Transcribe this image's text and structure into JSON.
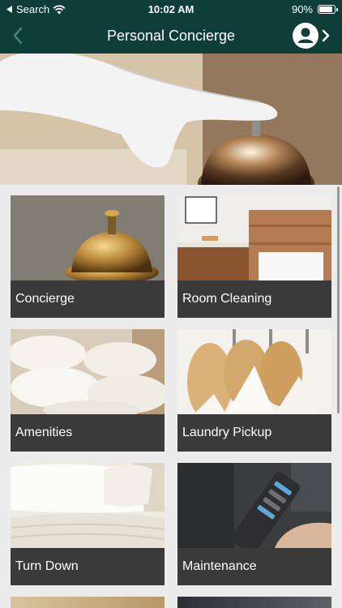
{
  "status_bar": {
    "back_app": "Search",
    "time": "10:02 AM",
    "battery": "90%",
    "battery_level": 0.9
  },
  "nav": {
    "title": "Personal Concierge",
    "back_icon": "chevron-left-icon",
    "profile_icon": "user-circle-icon"
  },
  "colors": {
    "nav_bg": "#0f3d3a",
    "tile_label_bg": "#3a3a3a",
    "page_bg": "#ececec"
  },
  "tiles": [
    {
      "label": "Concierge"
    },
    {
      "label": "Room Cleaning"
    },
    {
      "label": "Amenities"
    },
    {
      "label": "Laundry Pickup"
    },
    {
      "label": "Turn Down"
    },
    {
      "label": "Maintenance"
    }
  ]
}
